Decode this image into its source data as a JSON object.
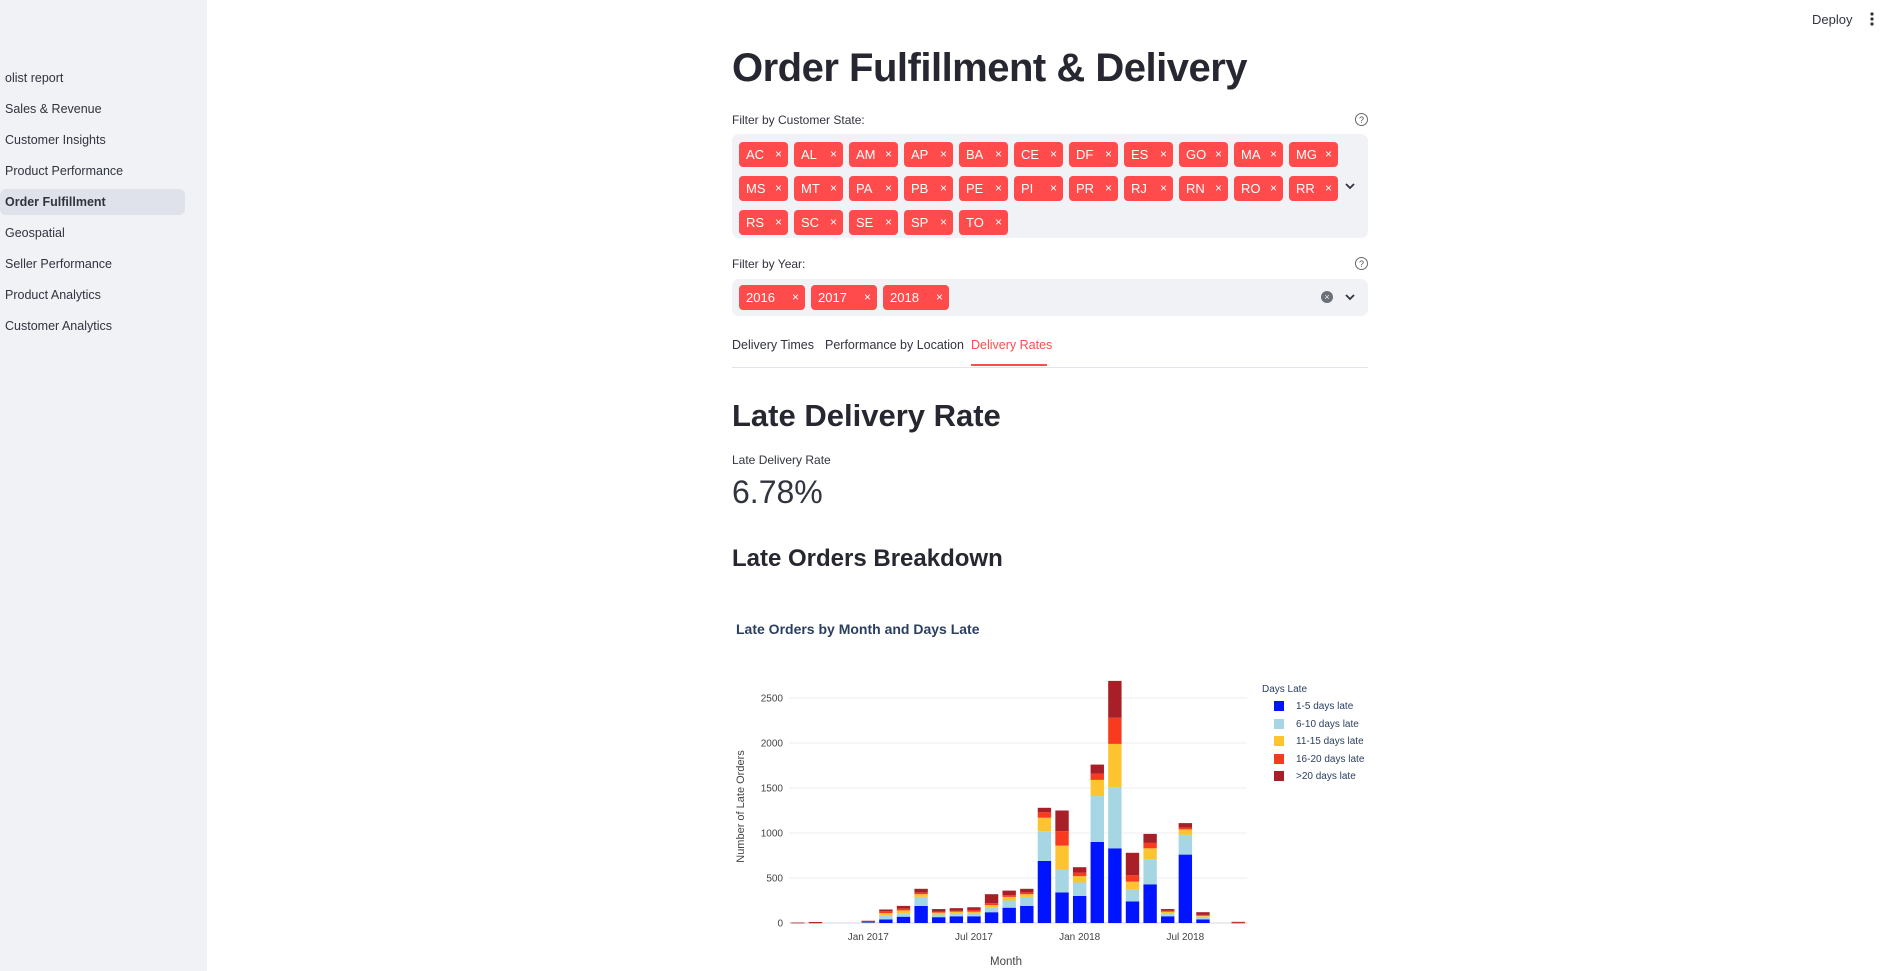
{
  "app": {
    "deploy_label": "Deploy"
  },
  "sidebar": {
    "items": [
      {
        "label": "olist report",
        "active": false
      },
      {
        "label": "Sales & Revenue",
        "active": false
      },
      {
        "label": "Customer Insights",
        "active": false
      },
      {
        "label": "Product Performance",
        "active": false
      },
      {
        "label": "Order Fulfillment",
        "active": true
      },
      {
        "label": "Geospatial",
        "active": false
      },
      {
        "label": "Seller Performance",
        "active": false
      },
      {
        "label": "Product Analytics",
        "active": false
      },
      {
        "label": "Customer Analytics",
        "active": false
      }
    ]
  },
  "page": {
    "title": "Order Fulfillment & Delivery",
    "state_filter": {
      "label": "Filter by Customer State:",
      "selected": [
        "AC",
        "AL",
        "AM",
        "AP",
        "BA",
        "CE",
        "DF",
        "ES",
        "GO",
        "MA",
        "MG",
        "MS",
        "MT",
        "PA",
        "PB",
        "PE",
        "PI",
        "PR",
        "RJ",
        "RN",
        "RO",
        "RR",
        "RS",
        "SC",
        "SE",
        "SP",
        "TO"
      ]
    },
    "year_filter": {
      "label": "Filter by Year:",
      "selected": [
        "2016",
        "2017",
        "2018"
      ]
    },
    "tabs": [
      {
        "label": "Delivery Times",
        "active": false
      },
      {
        "label": "Performance by Location",
        "active": false
      },
      {
        "label": "Delivery Rates",
        "active": true
      }
    ],
    "section_title": "Late Delivery Rate",
    "metric": {
      "label": "Late Delivery Rate",
      "value": "6.78%"
    },
    "subsection_title": "Late Orders Breakdown"
  },
  "chart_data": {
    "type": "bar",
    "stacked": true,
    "title": "Late Orders by Month and Days Late",
    "xlabel": "Month",
    "ylabel": "Number of Late Orders",
    "ylim": [
      0,
      2700
    ],
    "yticks": [
      0,
      500,
      1000,
      1500,
      2000,
      2500
    ],
    "xticks": [
      {
        "label": "Jan 2017",
        "month": "2017-01"
      },
      {
        "label": "Jul 2017",
        "month": "2017-07"
      },
      {
        "label": "Jan 2018",
        "month": "2018-01"
      },
      {
        "label": "Jul 2018",
        "month": "2018-07"
      }
    ],
    "legend_title": "Days Late",
    "legend_position": "top-right",
    "categories": [
      "2016-09",
      "2016-10",
      "2016-11",
      "2016-12",
      "2017-01",
      "2017-02",
      "2017-03",
      "2017-04",
      "2017-05",
      "2017-06",
      "2017-07",
      "2017-08",
      "2017-09",
      "2017-10",
      "2017-11",
      "2017-12",
      "2018-01",
      "2018-02",
      "2018-03",
      "2018-04",
      "2018-05",
      "2018-06",
      "2018-07",
      "2018-08",
      "2018-09",
      "2018-10"
    ],
    "series": [
      {
        "name": "1-5 days late",
        "color": "#0014ff",
        "values": [
          0,
          0,
          0,
          0,
          10,
          40,
          70,
          190,
          65,
          75,
          75,
          120,
          170,
          190,
          690,
          340,
          300,
          900,
          830,
          240,
          430,
          75,
          760,
          40,
          0,
          5
        ]
      },
      {
        "name": "6-10 days late",
        "color": "#a6d5e3",
        "values": [
          0,
          2,
          0,
          0,
          5,
          40,
          40,
          100,
          30,
          30,
          30,
          50,
          80,
          100,
          330,
          250,
          150,
          510,
          680,
          130,
          280,
          30,
          220,
          30,
          0,
          2
        ]
      },
      {
        "name": "11-15 days late",
        "color": "#fcc42e",
        "values": [
          0,
          2,
          0,
          0,
          3,
          30,
          30,
          30,
          20,
          20,
          20,
          30,
          40,
          30,
          150,
          270,
          70,
          180,
          480,
          90,
          120,
          20,
          60,
          10,
          0,
          2
        ]
      },
      {
        "name": "16-20 days late",
        "color": "#f83a1e",
        "values": [
          0,
          2,
          0,
          0,
          2,
          20,
          20,
          20,
          10,
          10,
          20,
          20,
          20,
          20,
          60,
          160,
          40,
          70,
          290,
          70,
          60,
          10,
          20,
          10,
          0,
          2
        ]
      },
      {
        "name": ">20 days late",
        "color": "#a91f27",
        "values": [
          5,
          5,
          0,
          0,
          5,
          20,
          30,
          40,
          30,
          30,
          30,
          100,
          50,
          40,
          50,
          230,
          60,
          100,
          410,
          250,
          100,
          20,
          50,
          30,
          0,
          2
        ]
      }
    ]
  }
}
